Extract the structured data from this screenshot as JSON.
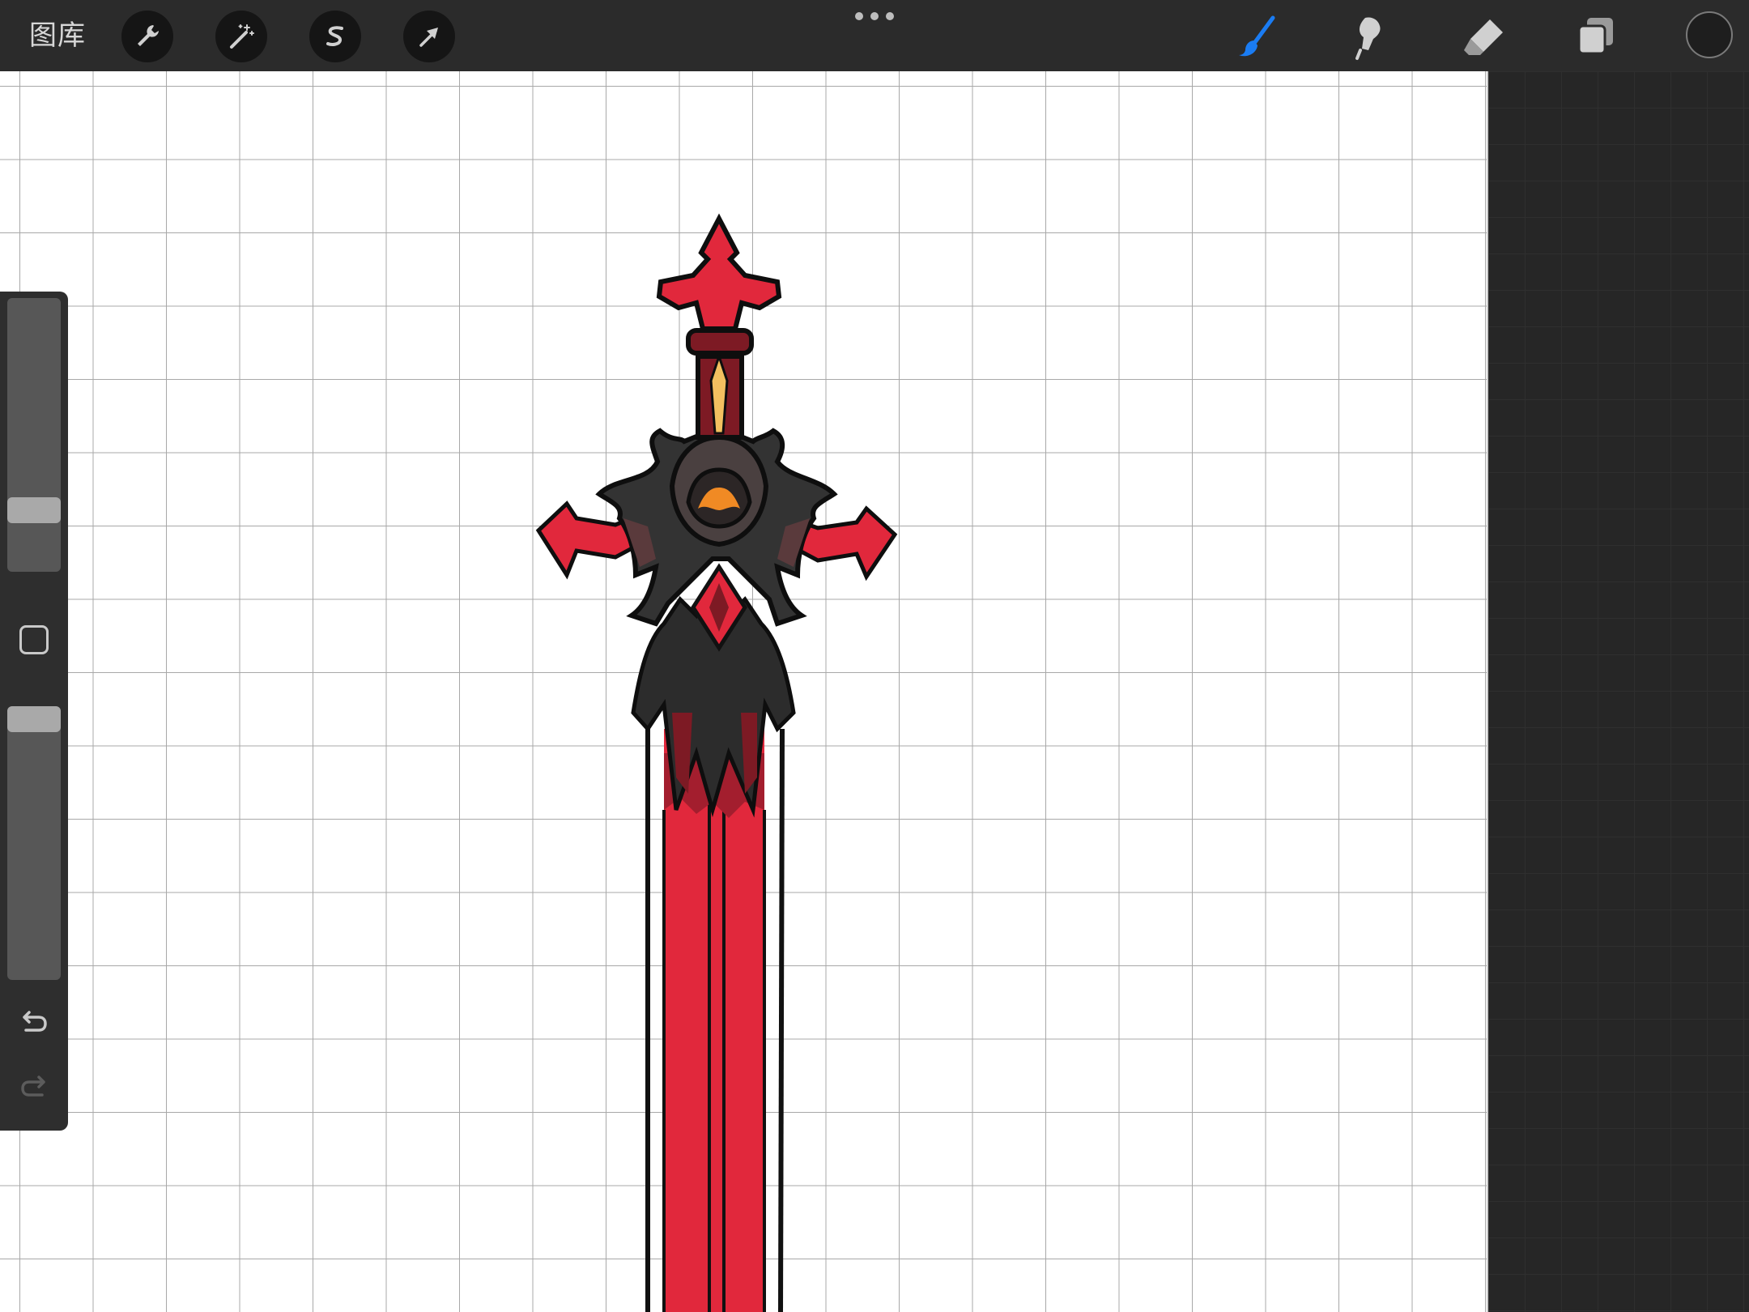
{
  "topbar": {
    "gallery_label": "图库",
    "left_tools": [
      {
        "icon": "wrench-icon",
        "name": "actions"
      },
      {
        "icon": "magic-wand-icon",
        "name": "adjustments"
      },
      {
        "icon": "selection-s-icon",
        "name": "selection"
      },
      {
        "icon": "transform-arrow-icon",
        "name": "transform"
      }
    ],
    "center": {
      "icon": "more-dots-icon"
    },
    "right_tools": [
      {
        "icon": "brush-icon",
        "name": "paint",
        "active": true
      },
      {
        "icon": "smudge-icon",
        "name": "smudge",
        "active": false
      },
      {
        "icon": "eraser-icon",
        "name": "eraser",
        "active": false
      },
      {
        "icon": "layers-icon",
        "name": "layers",
        "active": false
      }
    ],
    "color_swatch": "#1e1e1e"
  },
  "sidebar": {
    "brush_size_level": 0.23,
    "opacity_level": 0.95,
    "modify_button": {
      "icon": "square-modify-icon"
    },
    "undo": {
      "icon": "undo-icon"
    },
    "redo": {
      "icon": "redo-icon",
      "enabled": false
    }
  },
  "colors": {
    "accent_blue": "#1a7cf3",
    "blade_red": "#e1283c",
    "dark_red": "#7d1a24",
    "guard_gray": "#3b3b3b",
    "ember_orange": "#f08a24",
    "gold": "#f3c060"
  },
  "canvas": {
    "artwork": "sword-drawing",
    "grid": true
  }
}
